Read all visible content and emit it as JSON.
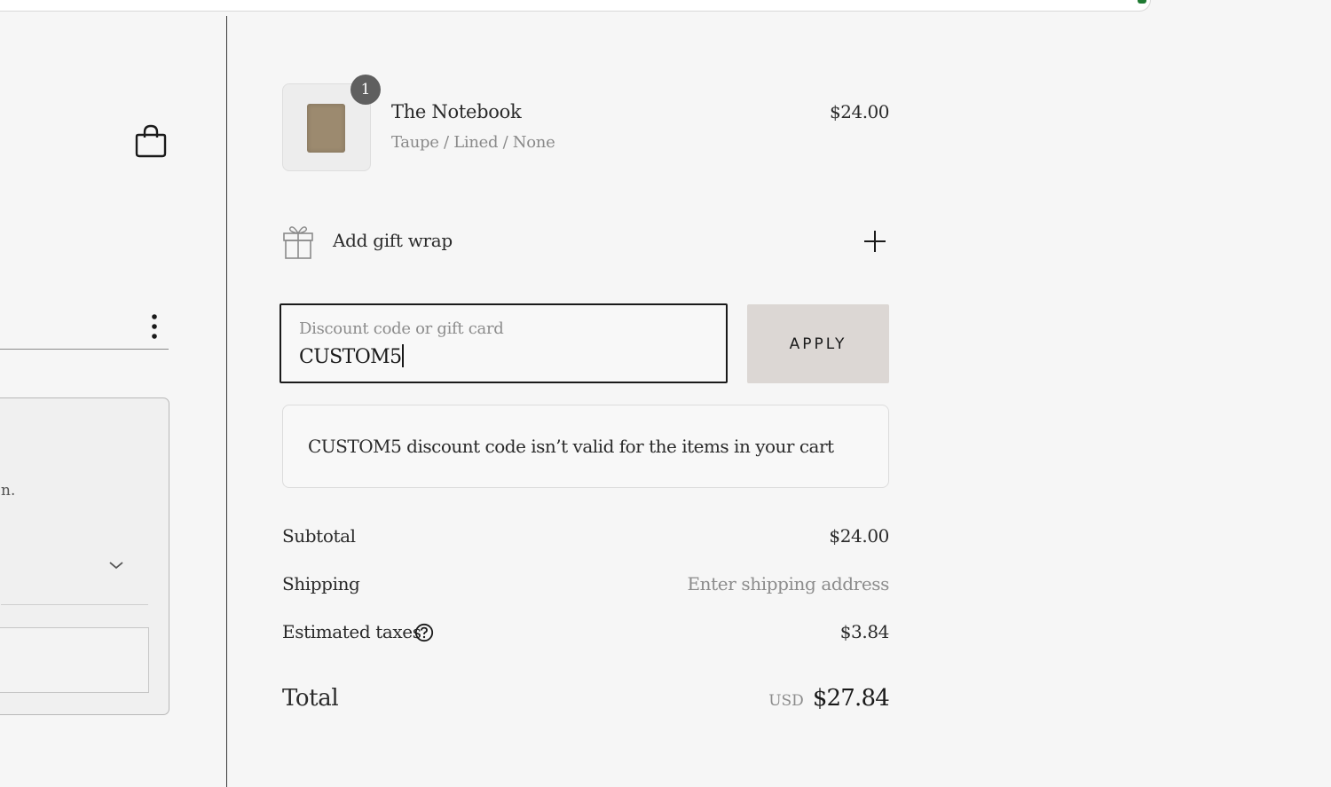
{
  "product": {
    "quantity": "1",
    "name": "The Notebook",
    "variant": "Taupe / Lined / None",
    "price": "$24.00",
    "thumbnail_color": "#9c8a6f"
  },
  "gift_wrap": {
    "label": "Add gift wrap",
    "icon": "gift-icon",
    "action_icon": "plus-icon"
  },
  "discount": {
    "placeholder": "Discount code or gift card",
    "value": "CUSTOM5",
    "apply_label": "APPLY",
    "error_message": "CUSTOM5 discount code isn’t valid for the items in your cart"
  },
  "summary": {
    "subtotal_label": "Subtotal",
    "subtotal_value": "$24.00",
    "shipping_label": "Shipping",
    "shipping_value": "Enter shipping address",
    "taxes_label": "Estimated taxes",
    "taxes_value": "$3.84",
    "total_label": "Total",
    "currency": "USD",
    "total_value": "$27.84"
  },
  "left_panel": {
    "card_text_fragment": "n.",
    "icons": [
      "bag-icon",
      "more-vertical-icon",
      "chevron-down-icon"
    ]
  },
  "colors": {
    "background": "#f6f6f6",
    "apply_button": "#dcd7d4",
    "badge": "#5f5f5f",
    "muted_text": "#8c8c8c"
  }
}
